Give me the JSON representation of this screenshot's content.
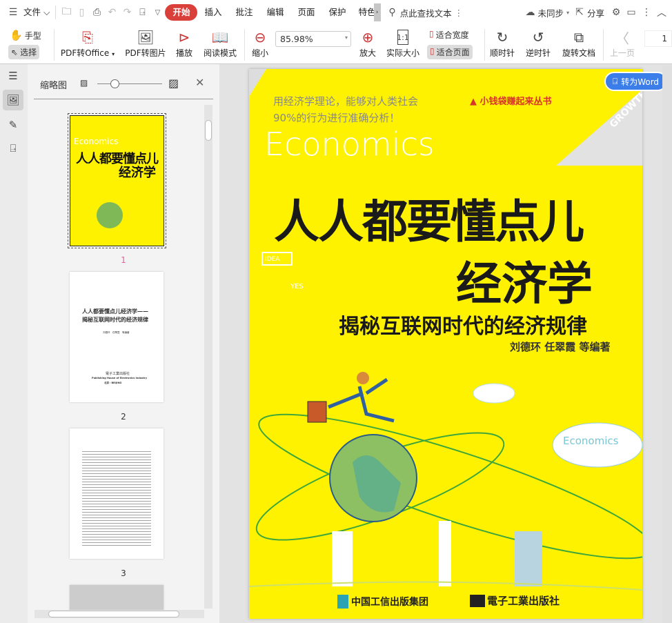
{
  "menubar": {
    "file": "文件",
    "tabs": [
      "开始",
      "插入",
      "批注",
      "编辑",
      "页面",
      "保护",
      "特色"
    ],
    "search": "点此查找文本",
    "sync": "未同步",
    "share": "分享"
  },
  "toolbar": {
    "hand": "手型",
    "select": "选择",
    "pdf_to_office": "PDF转Office",
    "pdf_to_image": "PDF转图片",
    "play": "播放",
    "read_mode": "阅读模式",
    "zoom_out": "缩小",
    "zoom_value": "85.98%",
    "zoom_in": "放大",
    "actual_size": "实际大小",
    "fit_width": "适合宽度",
    "fit_page": "适合页面",
    "rotate_cw": "顺时针",
    "rotate_ccw": "逆时针",
    "rotate_doc": "旋转文档",
    "prev_page": "上一页",
    "page_number": "1"
  },
  "thumbnails": {
    "title": "缩略图",
    "pages": [
      {
        "label": "1"
      },
      {
        "label": "2"
      },
      {
        "label": "3"
      }
    ],
    "page2": {
      "title1": "人人都要懂点儿经济学——",
      "title2": "揭秘互联网时代的经济规律",
      "authors": "刘德环　任翠霞　等编著",
      "publisher": "電子工業出版社",
      "publisher_en": "Publishing House of Electronics Industry",
      "city": "北京・BEIJING"
    }
  },
  "convert_button": "转为Word",
  "cover": {
    "tagline1": "用经济学理论，能够对人类社会",
    "tagline2": "90%的行为进行准确分析！",
    "series": "▲ 小钱袋赚起来丛书",
    "economics": "Economics",
    "title1": "人人都要懂点儿",
    "title2": "经济学",
    "subtitle": "揭秘互联网时代的经济规律",
    "authors": "刘德环 任翠霞 等编著",
    "cloud_text": "Economics",
    "publisher1": "中国工信出版集团",
    "publisher2": "電子工業出版社",
    "growth": "GROWTH",
    "idea": "IDEA",
    "yes": "YES"
  },
  "colors": {
    "accent": "#d9403a",
    "cover_yellow": "#fff200",
    "word_button": "#3b7de9"
  }
}
